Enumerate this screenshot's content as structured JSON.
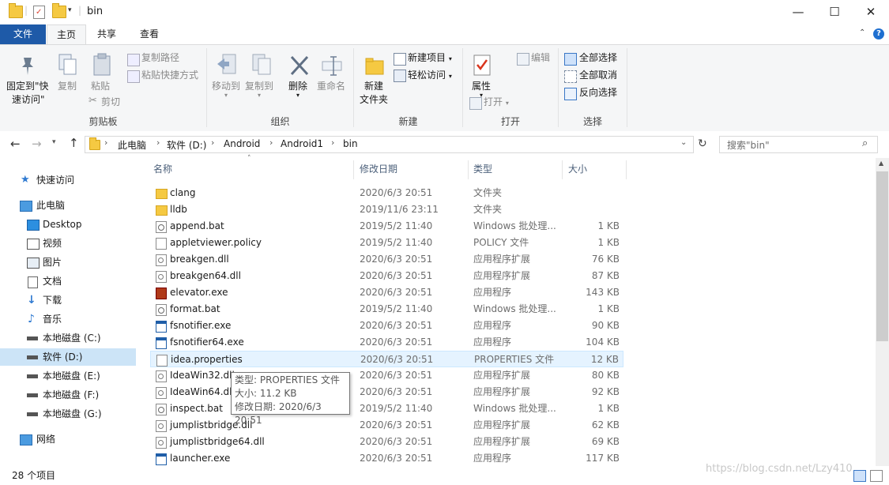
{
  "title": {
    "text": "bin"
  },
  "window": {
    "minimize": "—",
    "maximize": "☐",
    "close": "✕"
  },
  "tabs": {
    "file": "文件",
    "home": "主页",
    "share": "共享",
    "view": "查看"
  },
  "ribbon": {
    "clipboard": {
      "pin": "固定到\"快",
      "pin2": "速访问\"",
      "copy": "复制",
      "paste": "粘贴",
      "copy_path": "复制路径",
      "paste_shortcut": "粘贴快捷方式",
      "cut": "剪切",
      "label": "剪贴板"
    },
    "organize": {
      "move_to": "移动到",
      "copy_to": "复制到",
      "delete": "删除",
      "rename": "重命名",
      "label": "组织"
    },
    "new": {
      "new_folder": "新建",
      "new_folder2": "文件夹",
      "new_item": "新建项目",
      "easy_access": "轻松访问",
      "label": "新建"
    },
    "open": {
      "properties": "属性",
      "open": "打开",
      "edit": "编辑",
      "label": "打开"
    },
    "select": {
      "select_all": "全部选择",
      "select_none": "全部取消",
      "invert": "反向选择",
      "label": "选择"
    }
  },
  "address": {
    "crumbs": [
      "此电脑",
      "软件 (D:)",
      "Android",
      "Android1",
      "bin"
    ],
    "search_placeholder": "搜索\"bin\""
  },
  "nav": [
    {
      "label": "快速访问"
    },
    {
      "label": "此电脑"
    },
    {
      "label": "Desktop"
    },
    {
      "label": "视频"
    },
    {
      "label": "图片"
    },
    {
      "label": "文档"
    },
    {
      "label": "下载"
    },
    {
      "label": "音乐"
    },
    {
      "label": "本地磁盘 (C:)"
    },
    {
      "label": "软件 (D:)"
    },
    {
      "label": "本地磁盘 (E:)"
    },
    {
      "label": "本地磁盘 (F:)"
    },
    {
      "label": "本地磁盘 (G:)"
    },
    {
      "label": "网络"
    }
  ],
  "columns": {
    "name": "名称",
    "date": "修改日期",
    "type": "类型",
    "size": "大小"
  },
  "files": [
    {
      "name": "clang",
      "date": "2020/6/3 20:51",
      "type": "文件夹",
      "size": "",
      "icon": "folder"
    },
    {
      "name": "lldb",
      "date": "2019/11/6 23:11",
      "type": "文件夹",
      "size": "",
      "icon": "folder"
    },
    {
      "name": "append.bat",
      "date": "2019/5/2 11:40",
      "type": "Windows 批处理...",
      "size": "1 KB",
      "icon": "bat"
    },
    {
      "name": "appletviewer.policy",
      "date": "2019/5/2 11:40",
      "type": "POLICY 文件",
      "size": "1 KB",
      "icon": "file"
    },
    {
      "name": "breakgen.dll",
      "date": "2020/6/3 20:51",
      "type": "应用程序扩展",
      "size": "76 KB",
      "icon": "dll"
    },
    {
      "name": "breakgen64.dll",
      "date": "2020/6/3 20:51",
      "type": "应用程序扩展",
      "size": "87 KB",
      "icon": "dll"
    },
    {
      "name": "elevator.exe",
      "date": "2020/6/3 20:51",
      "type": "应用程序",
      "size": "143 KB",
      "icon": "elev"
    },
    {
      "name": "format.bat",
      "date": "2019/5/2 11:40",
      "type": "Windows 批处理...",
      "size": "1 KB",
      "icon": "bat"
    },
    {
      "name": "fsnotifier.exe",
      "date": "2020/6/3 20:51",
      "type": "应用程序",
      "size": "90 KB",
      "icon": "exe"
    },
    {
      "name": "fsnotifier64.exe",
      "date": "2020/6/3 20:51",
      "type": "应用程序",
      "size": "104 KB",
      "icon": "exe"
    },
    {
      "name": "idea.properties",
      "date": "2020/6/3 20:51",
      "type": "PROPERTIES 文件",
      "size": "12 KB",
      "icon": "file"
    },
    {
      "name": "IdeaWin32.dll",
      "date": "2020/6/3 20:51",
      "type": "应用程序扩展",
      "size": "80 KB",
      "icon": "dll"
    },
    {
      "name": "IdeaWin64.dll",
      "date": "2020/6/3 20:51",
      "type": "应用程序扩展",
      "size": "92 KB",
      "icon": "dll"
    },
    {
      "name": "inspect.bat",
      "date": "2019/5/2 11:40",
      "type": "Windows 批处理...",
      "size": "1 KB",
      "icon": "bat"
    },
    {
      "name": "jumplistbridge.dll",
      "date": "2020/6/3 20:51",
      "type": "应用程序扩展",
      "size": "62 KB",
      "icon": "dll"
    },
    {
      "name": "jumplistbridge64.dll",
      "date": "2020/6/3 20:51",
      "type": "应用程序扩展",
      "size": "69 KB",
      "icon": "dll"
    },
    {
      "name": "launcher.exe",
      "date": "2020/6/3 20:51",
      "type": "应用程序",
      "size": "117 KB",
      "icon": "exe"
    }
  ],
  "tooltip": {
    "line1": "类型: PROPERTIES 文件",
    "line2": "大小: 11.2 KB",
    "line3": "修改日期: 2020/6/3 20:51"
  },
  "status": {
    "count": "28 个项目"
  },
  "watermark": "https://blog.csdn.net/Lzy410"
}
